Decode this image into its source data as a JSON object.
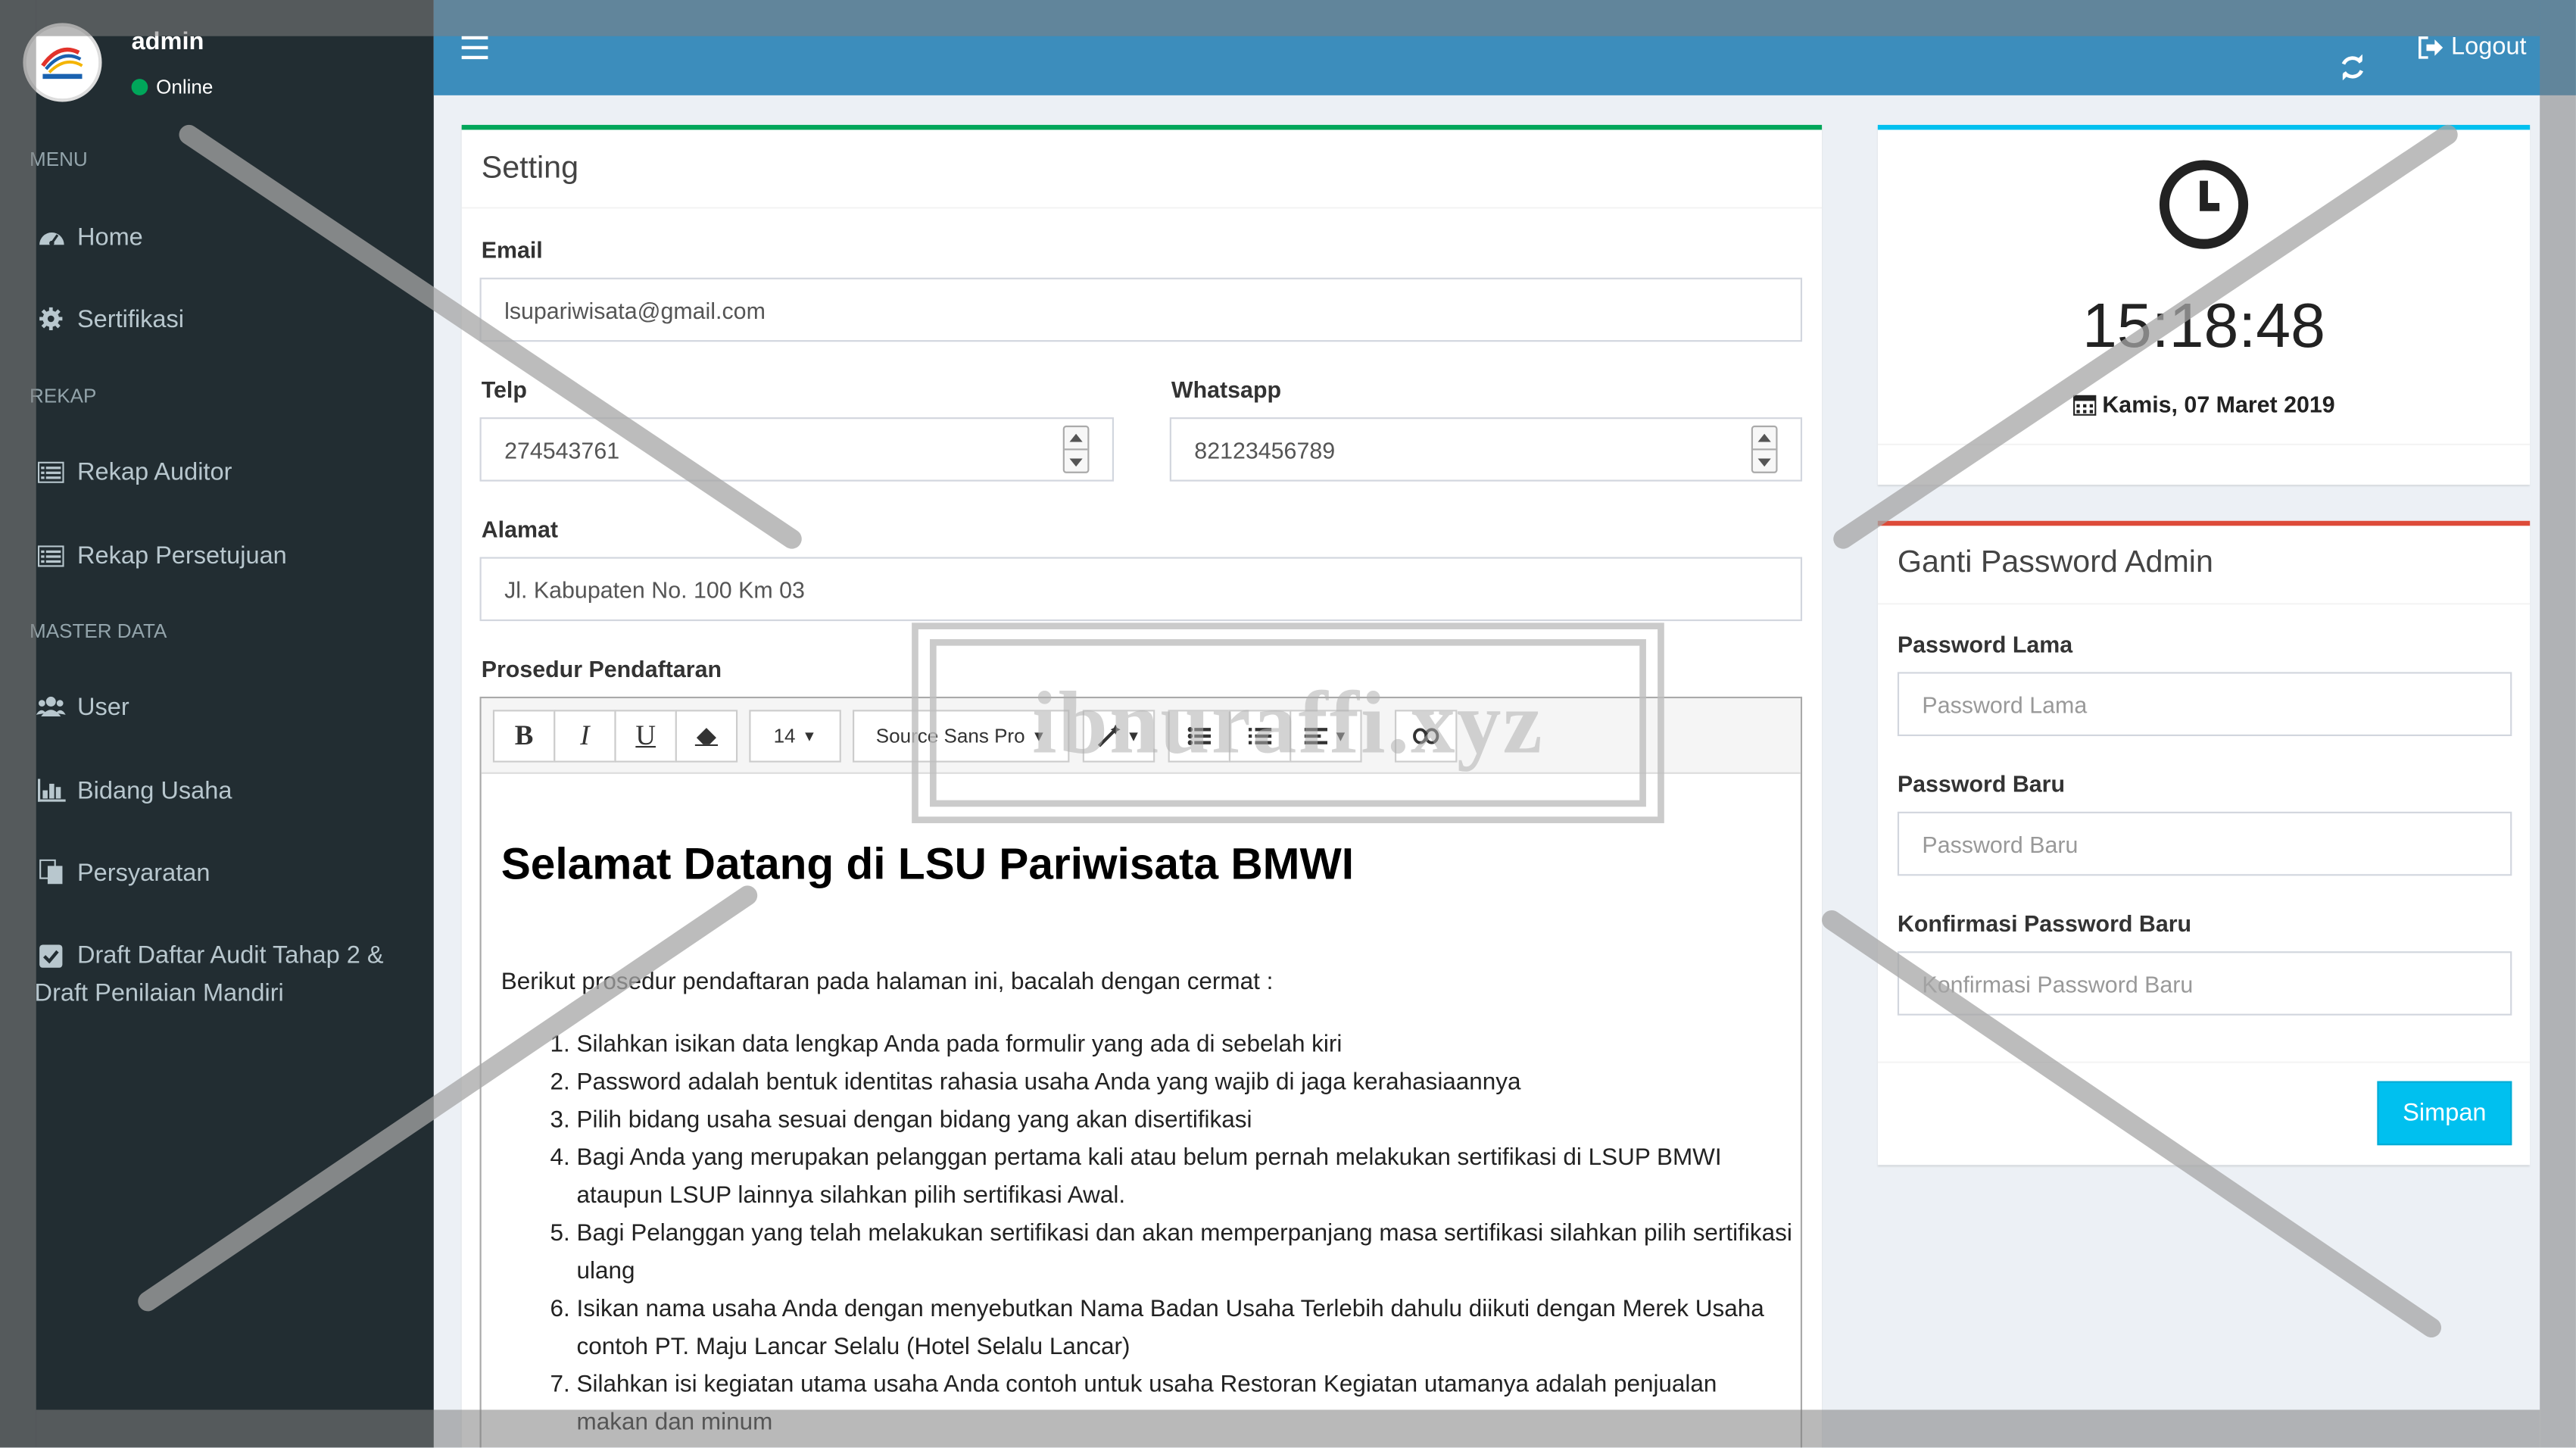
{
  "user": {
    "name": "admin",
    "status": "Online"
  },
  "menu": {
    "header_menu": "MENU",
    "header_rekap": "REKAP",
    "header_master": "MASTER DATA",
    "items": [
      {
        "label": "Home",
        "icon": "dashboard-icon"
      },
      {
        "label": "Sertifikasi",
        "icon": "gear-icon"
      },
      {
        "label": "Rekap Auditor",
        "icon": "list-icon"
      },
      {
        "label": "Rekap Persetujuan",
        "icon": "list-icon"
      },
      {
        "label": "User",
        "icon": "users-icon"
      },
      {
        "label": "Bidang Usaha",
        "icon": "chart-icon"
      },
      {
        "label": "Persyaratan",
        "icon": "copy-icon"
      },
      {
        "label_line1": "Draft Daftar Audit Tahap 2 &",
        "label_line2": "Draft Penilaian Mandiri",
        "icon": "check-square-icon"
      }
    ]
  },
  "topbar": {
    "logout_label": "Logout"
  },
  "setting": {
    "title": "Setting",
    "email_label": "Email",
    "email_value": "lsupariwisata@gmail.com",
    "telp_label": "Telp",
    "telp_value": "274543761",
    "whatsapp_label": "Whatsapp",
    "whatsapp_value": "82123456789",
    "alamat_label": "Alamat",
    "alamat_value": "Jl. Kabupaten No. 100 Km 03",
    "prosedur_label": "Prosedur Pendaftaran"
  },
  "editor": {
    "font_size": "14",
    "font_family": "Source Sans Pro",
    "heading": "Selamat Datang di LSU Pariwisata BMWI",
    "intro": "Berikut prosedur pendaftaran pada halaman ini, bacalah dengan cermat :",
    "steps": [
      "Silahkan isikan data lengkap Anda pada formulir yang ada di sebelah kiri",
      "Password adalah bentuk identitas rahasia usaha Anda yang wajib di jaga kerahasiaannya",
      "Pilih bidang usaha sesuai dengan bidang yang akan disertifikasi",
      "Bagi Anda yang merupakan pelanggan pertama kali atau belum pernah melakukan sertifikasi di LSUP BMWI ataupun LSUP lainnya silahkan pilih sertifikasi Awal.",
      "Bagi Pelanggan yang telah melakukan sertifikasi dan akan memperpanjang masa sertifikasi silahkan pilih sertifikasi ulang",
      "Isikan nama usaha Anda dengan menyebutkan Nama Badan Usaha Terlebih dahulu diikuti dengan Merek Usaha contoh PT. Maju Lancar Selalu (Hotel Selalu Lancar)",
      "Silahkan isi kegiatan utama usaha Anda contoh untuk usaha Restoran Kegiatan utamanya adalah penjualan makan dan minum"
    ]
  },
  "clock": {
    "time": "15:18:48",
    "date": "Kamis, 07 Maret 2019"
  },
  "password": {
    "title": "Ganti Password Admin",
    "old_label": "Password Lama",
    "old_placeholder": "Password Lama",
    "new_label": "Password Baru",
    "new_placeholder": "Password Baru",
    "confirm_label": "Konfirmasi Password Baru",
    "confirm_placeholder": "Konfirmasi Password Baru",
    "save_label": "Simpan"
  },
  "watermark": {
    "text": "ibnuraffi.xyz"
  },
  "colors": {
    "topbar": "#3c8dbc",
    "sidebar": "#222d32",
    "setting_border": "#00a65a",
    "clock_border": "#00c0ef",
    "password_border": "#dd4b39",
    "save_button": "#00c0ef"
  }
}
